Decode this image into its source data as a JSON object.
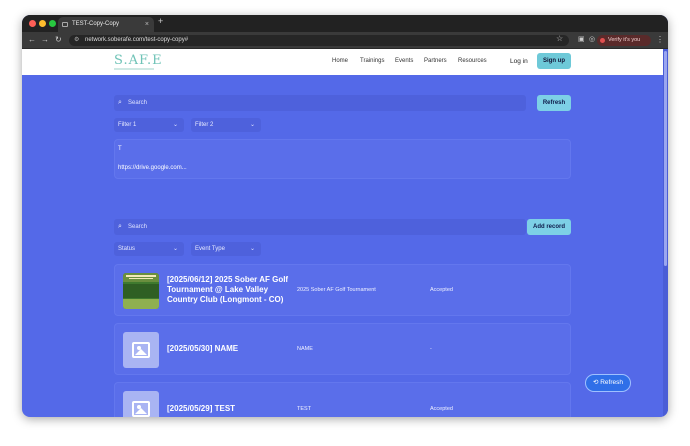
{
  "browser": {
    "tab_title": "TEST-Copy-Copy",
    "tab_close": "×",
    "new_tab": "+",
    "url": "network.soberafe.com/test-copy-copy#",
    "verify_label": "Verify it's you",
    "colors": {
      "close": "#ff5f57",
      "minimize": "#febc2e",
      "maximize": "#28c840"
    }
  },
  "site": {
    "logo_text": "S.AF.E",
    "nav": [
      "Home",
      "Trainings",
      "Events",
      "Partners",
      "Resources"
    ],
    "login_label": "Log in",
    "signup_label": "Sign up"
  },
  "top_section": {
    "search_placeholder": "Search",
    "refresh_label": "Refresh",
    "filters": [
      "Filter 1",
      "Filter 2"
    ],
    "panel_lines": [
      "T",
      "https://drive.google.com..."
    ]
  },
  "records_section": {
    "search_placeholder": "Search",
    "add_label": "Add record",
    "filters": [
      "Status",
      "Event Type"
    ]
  },
  "records": [
    {
      "title": "[2025/06/12] 2025 Sober AF Golf Tournament @ Lake Valley Country Club (Longmont - CO)",
      "name": "2025 Sober AF Golf Tournament",
      "status": "Accepted",
      "thumb": "golf-photo"
    },
    {
      "title": "[2025/05/30] NAME",
      "name": "NAME",
      "status": "-",
      "thumb": "image-icon"
    },
    {
      "title": "[2025/05/29] TEST",
      "name": "TEST",
      "status": "Accepted",
      "thumb": "image-icon"
    }
  ],
  "float_refresh_label": "⟲ Refresh",
  "accent": "#5469e8"
}
